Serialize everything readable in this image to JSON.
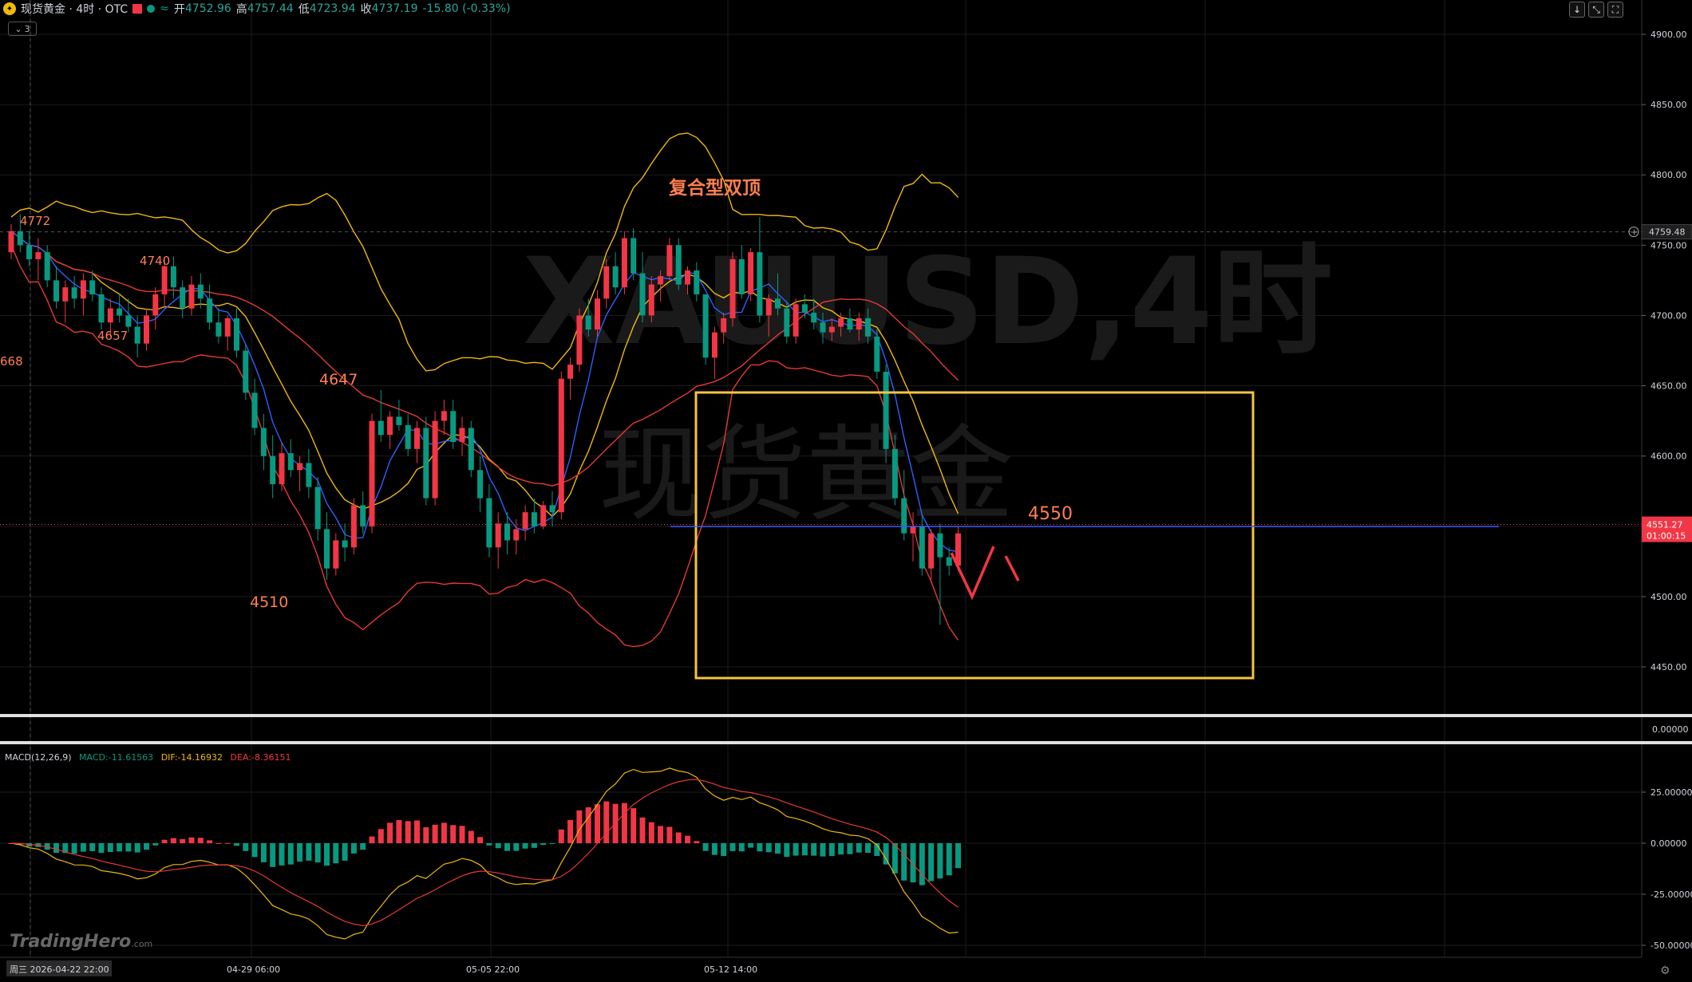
{
  "header": {
    "symbol_title": "现货黄金 · 4时 · OTC",
    "icon_glyph": "✦",
    "open_label": "开",
    "open": "4752.96",
    "high_label": "高",
    "high": "4757.44",
    "low_label": "低",
    "low": "4723.94",
    "close_label": "收",
    "close": "4737.19",
    "change": "-15.80 (-0.33%)",
    "collapse_count": "3"
  },
  "toolbar": {
    "down_glyph": "↓",
    "expand_glyph": "⤡",
    "fullscreen_glyph": "⛶"
  },
  "watermark": {
    "line1": "XAUUSD,4时",
    "line2": "现货黄金"
  },
  "brand": {
    "name": "TradingHero",
    "suffix": ".com"
  },
  "macd_legend": {
    "name": "MACD(12,26,9)",
    "macd": "MACD:-11.61563",
    "dif": "DIF:-14.16932",
    "dea": "DEA:-8.36151"
  },
  "colors": {
    "up": "#f23645",
    "down": "#089981",
    "ma_blue": "#2962ff",
    "ma_yellow": "#f0b90b",
    "ma_red": "#e53935",
    "box": "#f6c445",
    "annotation": "#ff7f50",
    "current_line": "#3a5bff"
  },
  "chart_data": {
    "type": "candlestick",
    "price_axis": {
      "min": 4430,
      "max": 4910,
      "ticks": [
        "4900.00",
        "4850.00",
        "4800.00",
        "4750.00",
        "4700.00",
        "4650.00",
        "4600.00",
        "4550.00",
        "4500.00",
        "4450.00"
      ]
    },
    "x_axis": {
      "labels": [
        "周三 2026-04-22 22:00",
        "04-29 06:00",
        "05-05 22:00",
        "05-12 14:00"
      ]
    },
    "price_labels": {
      "crosshair": "4759.48",
      "current": "4551.27",
      "countdown": "01:00:15"
    },
    "annotations": [
      "4772",
      "4740",
      "4657",
      "668",
      "4647",
      "4510",
      "复合型双顶",
      "4550"
    ],
    "candles": [
      [
        4745,
        4765,
        4740,
        4760
      ],
      [
        4760,
        4772,
        4745,
        4750
      ],
      [
        4750,
        4760,
        4735,
        4740
      ],
      [
        4740,
        4755,
        4725,
        4745
      ],
      [
        4745,
        4750,
        4720,
        4725
      ],
      [
        4725,
        4735,
        4705,
        4710
      ],
      [
        4710,
        4725,
        4695,
        4720
      ],
      [
        4720,
        4728,
        4705,
        4712
      ],
      [
        4712,
        4730,
        4700,
        4725
      ],
      [
        4725,
        4732,
        4710,
        4715
      ],
      [
        4715,
        4720,
        4690,
        4695
      ],
      [
        4695,
        4712,
        4685,
        4705
      ],
      [
        4705,
        4715,
        4695,
        4700
      ],
      [
        4700,
        4712,
        4688,
        4692
      ],
      [
        4692,
        4700,
        4670,
        4680
      ],
      [
        4680,
        4705,
        4675,
        4700
      ],
      [
        4700,
        4720,
        4690,
        4715
      ],
      [
        4715,
        4740,
        4705,
        4735
      ],
      [
        4735,
        4742,
        4712,
        4720
      ],
      [
        4720,
        4725,
        4698,
        4705
      ],
      [
        4705,
        4728,
        4700,
        4722
      ],
      [
        4722,
        4730,
        4705,
        4712
      ],
      [
        4712,
        4722,
        4690,
        4695
      ],
      [
        4695,
        4705,
        4680,
        4685
      ],
      [
        4685,
        4700,
        4675,
        4698
      ],
      [
        4698,
        4705,
        4670,
        4675
      ],
      [
        4675,
        4680,
        4640,
        4645
      ],
      [
        4645,
        4655,
        4615,
        4620
      ],
      [
        4620,
        4630,
        4590,
        4600
      ],
      [
        4600,
        4615,
        4570,
        4580
      ],
      [
        4580,
        4610,
        4575,
        4602
      ],
      [
        4602,
        4612,
        4585,
        4590
      ],
      [
        4590,
        4600,
        4575,
        4595
      ],
      [
        4595,
        4605,
        4570,
        4578
      ],
      [
        4578,
        4585,
        4540,
        4548
      ],
      [
        4548,
        4560,
        4512,
        4520
      ],
      [
        4520,
        4545,
        4515,
        4540
      ],
      [
        4540,
        4552,
        4525,
        4535
      ],
      [
        4535,
        4570,
        4530,
        4565
      ],
      [
        4565,
        4575,
        4545,
        4550
      ],
      [
        4550,
        4630,
        4545,
        4625
      ],
      [
        4625,
        4647,
        4610,
        4615
      ],
      [
        4615,
        4632,
        4605,
        4628
      ],
      [
        4628,
        4640,
        4618,
        4622
      ],
      [
        4622,
        4630,
        4600,
        4605
      ],
      [
        4605,
        4625,
        4595,
        4620
      ],
      [
        4620,
        4628,
        4565,
        4570
      ],
      [
        4570,
        4632,
        4565,
        4625
      ],
      [
        4625,
        4640,
        4615,
        4632
      ],
      [
        4632,
        4640,
        4605,
        4610
      ],
      [
        4610,
        4628,
        4600,
        4620
      ],
      [
        4620,
        4625,
        4585,
        4590
      ],
      [
        4590,
        4600,
        4560,
        4570
      ],
      [
        4570,
        4580,
        4528,
        4535
      ],
      [
        4535,
        4560,
        4520,
        4552
      ],
      [
        4552,
        4560,
        4530,
        4540
      ],
      [
        4540,
        4555,
        4530,
        4548
      ],
      [
        4548,
        4565,
        4540,
        4560
      ],
      [
        4560,
        4570,
        4545,
        4550
      ],
      [
        4550,
        4568,
        4548,
        4565
      ],
      [
        4565,
        4575,
        4550,
        4560
      ],
      [
        4560,
        4660,
        4555,
        4655
      ],
      [
        4655,
        4670,
        4640,
        4665
      ],
      [
        4665,
        4705,
        4660,
        4700
      ],
      [
        4700,
        4712,
        4685,
        4690
      ],
      [
        4690,
        4718,
        4685,
        4712
      ],
      [
        4712,
        4740,
        4705,
        4735
      ],
      [
        4735,
        4745,
        4715,
        4720
      ],
      [
        4720,
        4760,
        4715,
        4755
      ],
      [
        4755,
        4762,
        4725,
        4730
      ],
      [
        4730,
        4745,
        4695,
        4700
      ],
      [
        4700,
        4728,
        4695,
        4722
      ],
      [
        4722,
        4732,
        4710,
        4728
      ],
      [
        4728,
        4755,
        4725,
        4750
      ],
      [
        4750,
        4755,
        4718,
        4722
      ],
      [
        4722,
        4735,
        4715,
        4732
      ],
      [
        4732,
        4738,
        4710,
        4715
      ],
      [
        4715,
        4715,
        4665,
        4670
      ],
      [
        4670,
        4692,
        4655,
        4688
      ],
      [
        4688,
        4702,
        4680,
        4698
      ],
      [
        4698,
        4745,
        4692,
        4740
      ],
      [
        4740,
        4750,
        4712,
        4715
      ],
      [
        4715,
        4748,
        4710,
        4745
      ],
      [
        4745,
        4770,
        4695,
        4700
      ],
      [
        4700,
        4715,
        4685,
        4712
      ],
      [
        4712,
        4730,
        4700,
        4705
      ],
      [
        4705,
        4710,
        4680,
        4685
      ],
      [
        4685,
        4712,
        4680,
        4708
      ],
      [
        4708,
        4715,
        4698,
        4702
      ],
      [
        4702,
        4712,
        4690,
        4695
      ],
      [
        4695,
        4702,
        4680,
        4688
      ],
      [
        4688,
        4698,
        4682,
        4692
      ],
      [
        4692,
        4702,
        4685,
        4698
      ],
      [
        4698,
        4705,
        4688,
        4690
      ],
      [
        4690,
        4702,
        4682,
        4698
      ],
      [
        4698,
        4705,
        4680,
        4685
      ],
      [
        4685,
        4690,
        4655,
        4660
      ],
      [
        4660,
        4665,
        4595,
        4605
      ],
      [
        4605,
        4615,
        4565,
        4570
      ],
      [
        4570,
        4590,
        4540,
        4545
      ],
      [
        4545,
        4560,
        4525,
        4550
      ],
      [
        4550,
        4558,
        4515,
        4520
      ],
      [
        4520,
        4548,
        4510,
        4545
      ],
      [
        4545,
        4552,
        4480,
        4528
      ],
      [
        4528,
        4535,
        4515,
        4522
      ],
      [
        4522,
        4550,
        4518,
        4545
      ]
    ],
    "macd_panel": {
      "ylim": [
        -55,
        40
      ],
      "ticks": [
        "25.00000",
        "0.00000",
        "-25.00000",
        "-50.00000"
      ],
      "separator_value": "0.00000"
    }
  }
}
